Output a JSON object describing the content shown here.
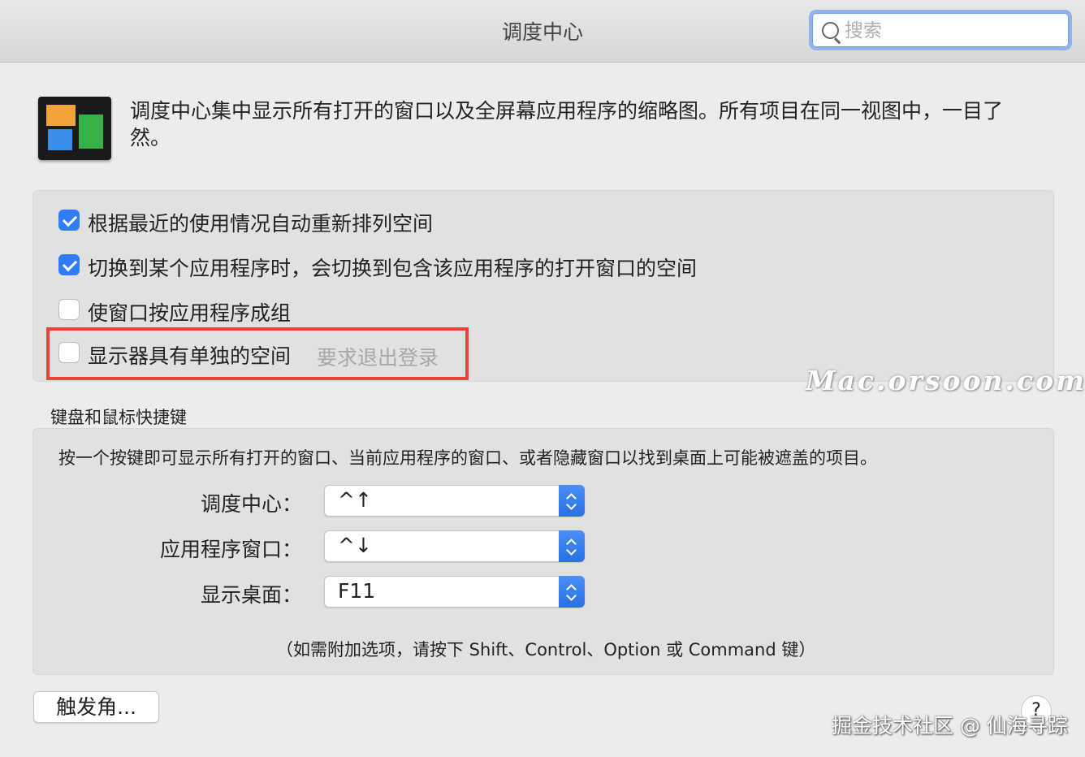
{
  "window": {
    "title": "调度中心"
  },
  "search": {
    "placeholder": "搜索",
    "value": ""
  },
  "intro": {
    "icon": "mission-control-icon",
    "description": "调度中心集中显示所有打开的窗口以及全屏幕应用程序的缩略图。所有项目在同一视图中，一目了然。"
  },
  "options": [
    {
      "label": "根据最近的使用情况自动重新排列空间",
      "checked": true
    },
    {
      "label": "切换到某个应用程序时，会切换到包含该应用程序的打开窗口的空间",
      "checked": true
    },
    {
      "label": "使窗口按应用程序成组",
      "checked": false
    },
    {
      "label": "显示器具有单独的空间",
      "checked": false,
      "note": "要求退出登录"
    }
  ],
  "watermark": "Mac.orsoon.com",
  "shortcuts": {
    "section_title": "键盘和鼠标快捷键",
    "description": "按一个按键即可显示所有打开的窗口、当前应用程序的窗口、或者隐藏窗口以找到桌面上可能被遮盖的项目。",
    "items": [
      {
        "label": "调度中心：",
        "value": "^↑"
      },
      {
        "label": "应用程序窗口：",
        "value": "^↓"
      },
      {
        "label": "显示桌面：",
        "value": "F11"
      }
    ],
    "hint": "（如需附加选项，请按下 Shift、Control、Option 或 Command 键）"
  },
  "footer": {
    "hot_corners_button": "触发角...",
    "help_button": "?",
    "credit": "掘金技术社区 @ 仙海寻踪"
  },
  "colors": {
    "accent": "#2f7cf6",
    "highlight_border": "#e8443a"
  }
}
